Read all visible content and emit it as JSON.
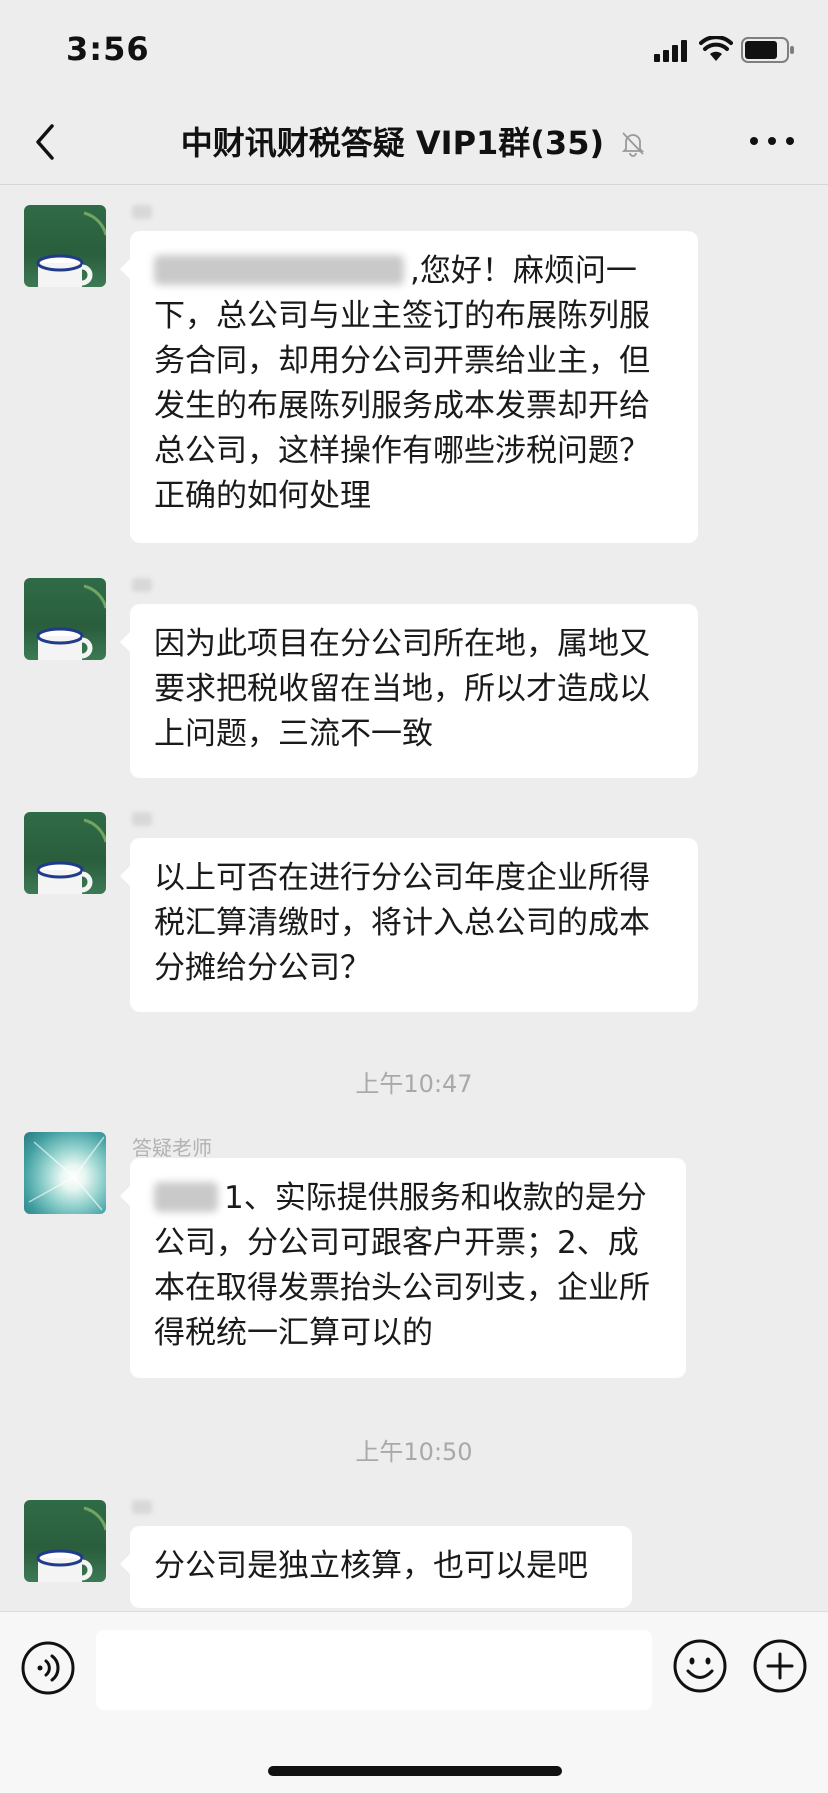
{
  "status_bar": {
    "time": "3:56"
  },
  "nav": {
    "title": "中财讯财税答疑 VIP1群(35)"
  },
  "messages": [
    {
      "sender": "",
      "text": ",您好！麻烦问一下，总公司与业主签订的布展陈列服务合同，却用分公司开票给业主，但发生的布展陈列服务成本发票却开给总公司，这样操作有哪些涉税问题？正确的如何处理"
    },
    {
      "sender": "",
      "text": "因为此项目在分公司所在地，属地又要求把税收留在当地，所以才造成以上问题，三流不一致"
    },
    {
      "sender": "",
      "text": "以上可否在进行分公司年度企业所得税汇算清缴时，将计入总公司的成本分摊给分公司？"
    },
    {
      "time": "上午10:47"
    },
    {
      "sender": "答疑老师",
      "text": "1、实际提供服务和收款的是分公司，分公司可跟客户开票；2、成本在取得发票抬头公司列支，企业所得税统一汇算可以的"
    },
    {
      "time": "上午10:50"
    },
    {
      "sender": "",
      "text": "分公司是独立核算，也可以是吧"
    }
  ],
  "input_bar": {
    "placeholder": ""
  },
  "icons": {
    "back": "chevron-left-icon",
    "mute": "bell-off-icon",
    "more": "more-horizontal-icon",
    "voice": "voice-icon",
    "emoji": "smile-icon",
    "plus": "plus-circle-icon"
  },
  "colors": {
    "background": "#ededed",
    "bubble": "#ffffff",
    "timestamp": "#a9a9a9"
  }
}
